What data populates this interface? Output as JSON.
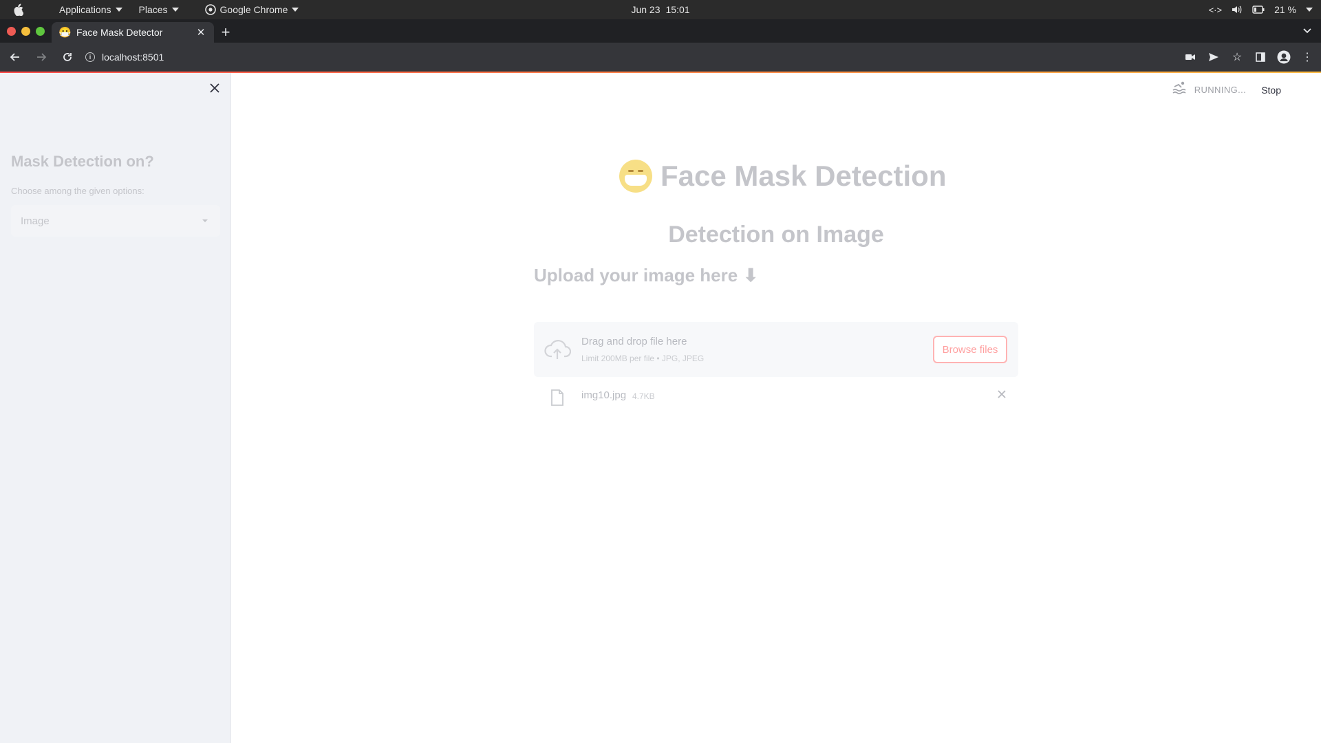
{
  "system_bar": {
    "applications_label": "Applications",
    "places_label": "Places",
    "app_label": "Google Chrome",
    "date": "Jun 23",
    "time": "15:01",
    "battery": "21 %"
  },
  "browser": {
    "tab_title": "Face Mask Detector",
    "url": "localhost:8501"
  },
  "sidebar": {
    "heading": "Mask Detection on?",
    "select_label": "Choose among the given options:",
    "select_value": "Image"
  },
  "status": {
    "running": "RUNNING...",
    "stop": "Stop"
  },
  "main": {
    "title": "Face Mask Detection",
    "subtitle": "Detection on Image",
    "upload_heading": "Upload your image here",
    "upload_arrow": "⬇",
    "dropzone_text": "Drag and drop file here",
    "dropzone_limit": "Limit 200MB per file • JPG, JPEG",
    "browse_label": "Browse files",
    "file_name": "img10.jpg",
    "file_size": "4.7KB"
  },
  "colors": {
    "accent": "#ff4b4b",
    "sidebar_bg": "#f0f2f6",
    "faded_text": "#c4c5ca"
  }
}
